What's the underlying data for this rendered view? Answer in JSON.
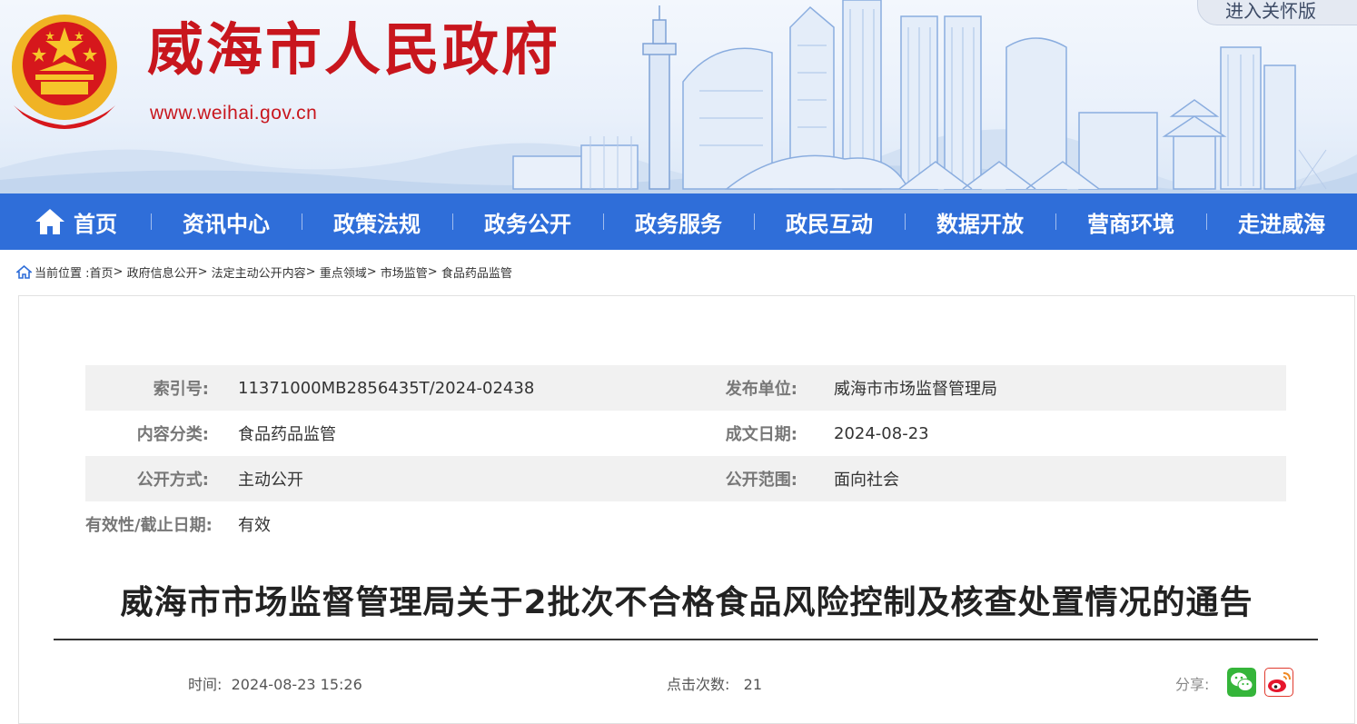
{
  "header": {
    "site_title": "威海市人民政府",
    "site_url": "www.weihai.gov.cn",
    "care_mode_label": "进入关怀版",
    "emblem_icon": "national-emblem-icon",
    "brand_color": "#c8161d"
  },
  "nav": {
    "color": "#2f6ed9",
    "items": [
      {
        "label": "首页",
        "icon": "home-icon"
      },
      {
        "label": "资讯中心"
      },
      {
        "label": "政策法规"
      },
      {
        "label": "政务公开"
      },
      {
        "label": "政务服务"
      },
      {
        "label": "政民互动"
      },
      {
        "label": "数据开放"
      },
      {
        "label": "营商环境"
      },
      {
        "label": "走进威海"
      }
    ]
  },
  "breadcrumb": {
    "prefix": "当前位置 :",
    "items": [
      "首页",
      "政府信息公开",
      "法定主动公开内容",
      "重点领域",
      "市场监管",
      "食品药品监管"
    ],
    "separator": ">"
  },
  "meta": {
    "index_label": "索引号:",
    "index_value": "11371000MB2856435T/2024-02438",
    "publisher_label": "发布单位:",
    "publisher_value": "威海市市场监督管理局",
    "category_label": "内容分类:",
    "category_value": "食品药品监管",
    "date_label": "成文日期:",
    "date_value": "2024-08-23",
    "method_label": "公开方式:",
    "method_value": "主动公开",
    "scope_label": "公开范围:",
    "scope_value": "面向社会",
    "validity_label": "有效性/截止日期:",
    "validity_value": "有效"
  },
  "article": {
    "title": "威海市市场监督管理局关于2批次不合格食品风险控制及核查处置情况的通告",
    "time_label": "时间:",
    "time_value": "2024-08-23 15:26",
    "clicks_label": "点击次数:",
    "clicks_value": "21",
    "share_label": "分享:",
    "share_icons": [
      "wechat-icon",
      "weibo-icon"
    ]
  }
}
